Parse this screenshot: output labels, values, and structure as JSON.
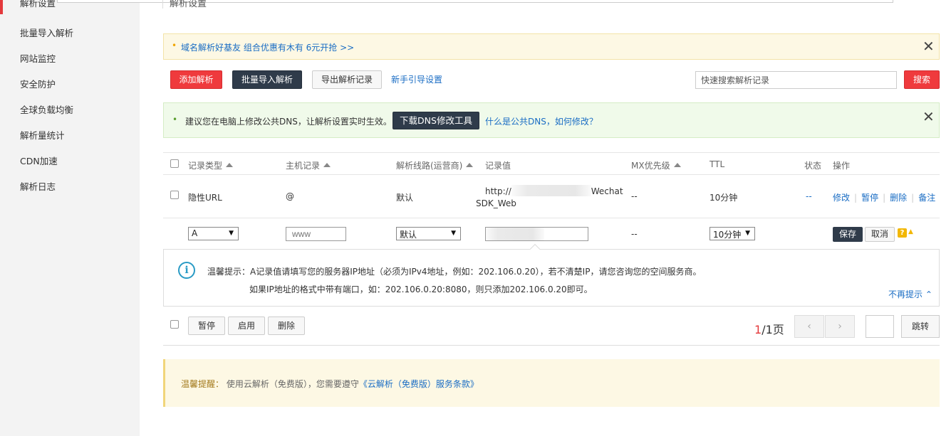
{
  "sidebar": {
    "active": "解析设置",
    "items": [
      "批量导入解析",
      "网站监控",
      "安全防护",
      "全球负载均衡",
      "解析量统计",
      "CDN加速",
      "解析日志"
    ]
  },
  "page": {
    "heading": "解析设置"
  },
  "promo": {
    "text": "域名解析好基友 组合优惠有木有 6元开抢 >>"
  },
  "toolbar": {
    "add": "添加解析",
    "batch_import": "批量导入解析",
    "export": "导出解析记录",
    "guide": "新手引导设置",
    "search_placeholder": "快速搜索解析记录",
    "search": "搜索"
  },
  "dns_notice": {
    "text": "建议您在电脑上修改公共DNS，让解析设置实时生效。",
    "download": "下载DNS修改工具",
    "help_link": "什么是公共DNS，如何修改？"
  },
  "table": {
    "headers": {
      "type": "记录类型",
      "host": "主机记录",
      "line": "解析线路(运营商)",
      "value": "记录值",
      "mx": "MX优先级",
      "ttl": "TTL",
      "status": "状态",
      "ops": "操作"
    },
    "row": {
      "type": "隐性URL",
      "host": "@",
      "line": "默认",
      "value_prefix": "http://",
      "value_suffix": "Wechat",
      "value_line2": "SDK_Web",
      "mx": "--",
      "ttl": "10分钟",
      "status": "--",
      "ops": [
        "修改",
        "暂停",
        "删除",
        "备注"
      ]
    },
    "edit": {
      "type": "A",
      "host_placeholder": "www",
      "line": "默认",
      "mx": "--",
      "ttl": "10分钟",
      "save": "保存",
      "cancel": "取消"
    }
  },
  "tip": {
    "label": "温馨提示：",
    "line1": "A记录值请填写您的服务器IP地址（必须为IPv4地址，例如：202.106.0.20），若不清楚IP，请您咨询您的空间服务商。",
    "line2": "如果IP地址的格式中带有端口，如：202.106.0.20:8080，则只添加202.106.0.20即可。",
    "dismiss": "不再提示"
  },
  "bulk": {
    "pause": "暂停",
    "enable": "启用",
    "delete": "删除"
  },
  "pager": {
    "current": "1",
    "total": "/1页",
    "jump": "跳转"
  },
  "footer": {
    "label": "温馨提醒：",
    "text": "使用云解析（免费版），您需要遵守",
    "link": "《云解析（免费版）服务条款》"
  },
  "colors": {
    "brand_red": "#ef3a3d",
    "dark_button": "#2f3b4a",
    "link_blue": "#1a6dc4"
  }
}
